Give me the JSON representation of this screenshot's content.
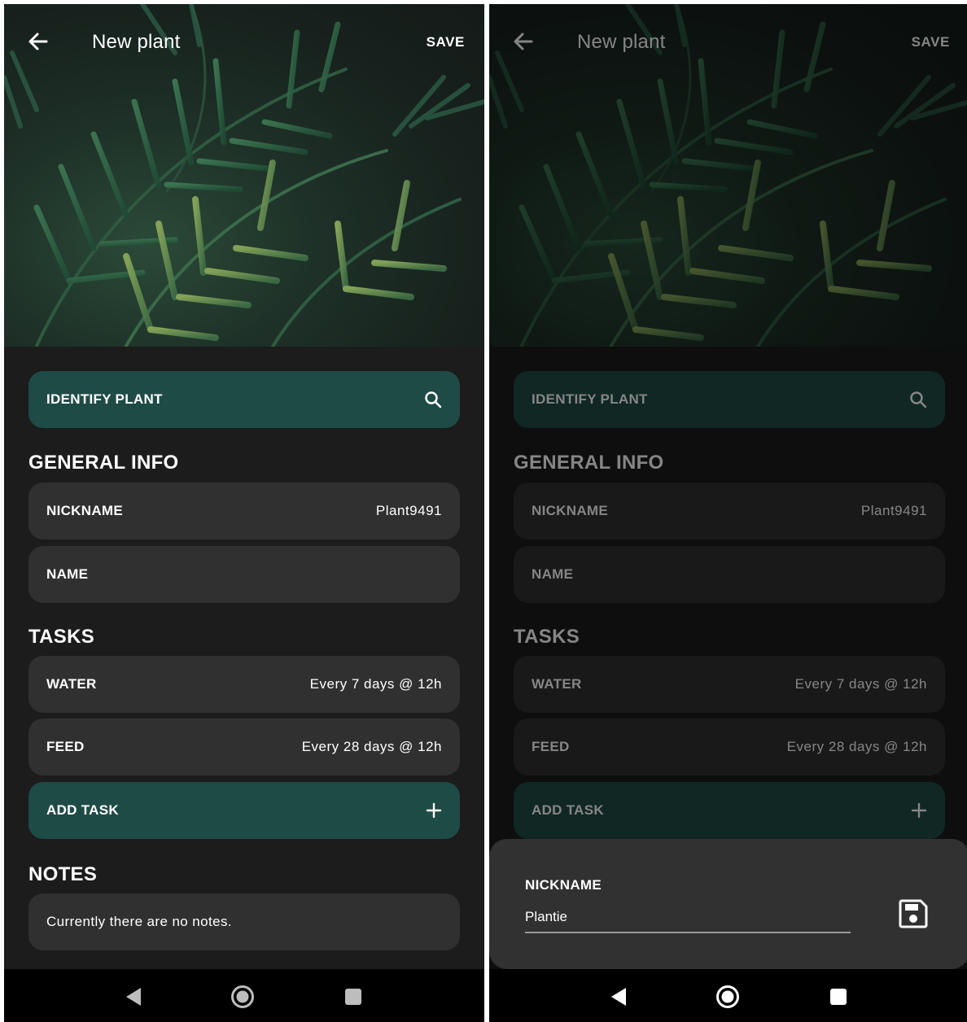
{
  "screens": [
    {
      "id": "left",
      "appbar": {
        "title": "New plant",
        "save_label": "SAVE",
        "back_icon": "arrow-left-icon"
      },
      "identify": {
        "label": "IDENTIFY PLANT",
        "icon": "search-icon"
      },
      "general_info": {
        "heading": "GENERAL INFO",
        "nickname": {
          "label": "NICKNAME",
          "value": "Plant9491"
        },
        "name": {
          "label": "NAME",
          "value": ""
        }
      },
      "tasks": {
        "heading": "TASKS",
        "items": [
          {
            "label": "WATER",
            "value": "Every 7 days @ 12h"
          },
          {
            "label": "FEED",
            "value": "Every 28 days @ 12h"
          }
        ],
        "add_label": "ADD TASK",
        "add_icon": "plus-icon"
      },
      "notes": {
        "heading": "NOTES",
        "text": "Currently there are no notes."
      }
    },
    {
      "id": "right",
      "appbar": {
        "title": "New plant",
        "save_label": "SAVE",
        "back_icon": "arrow-left-icon"
      },
      "identify": {
        "label": "IDENTIFY PLANT",
        "icon": "search-icon"
      },
      "general_info": {
        "heading": "GENERAL INFO",
        "nickname": {
          "label": "NICKNAME",
          "value": "Plant9491"
        },
        "name": {
          "label": "NAME",
          "value": ""
        }
      },
      "tasks": {
        "heading": "TASKS",
        "items": [
          {
            "label": "WATER",
            "value": "Every 7 days @ 12h"
          },
          {
            "label": "FEED",
            "value": "Every 28 days @ 12h"
          }
        ],
        "add_label": "ADD TASK",
        "add_icon": "plus-icon"
      },
      "bottom_sheet": {
        "label": "NICKNAME",
        "value": "Plantie",
        "icon": "save-disk-icon"
      }
    }
  ],
  "navigation_bar": {
    "icons": [
      "nav-back-icon",
      "nav-home-icon",
      "nav-recents-icon"
    ]
  },
  "colors": {
    "background": "#1c1c1c",
    "row": "#303030",
    "accent_button": "#1f4b46",
    "text": "#ffffff",
    "sheet": "#313131",
    "nav_bar": "#000000"
  }
}
